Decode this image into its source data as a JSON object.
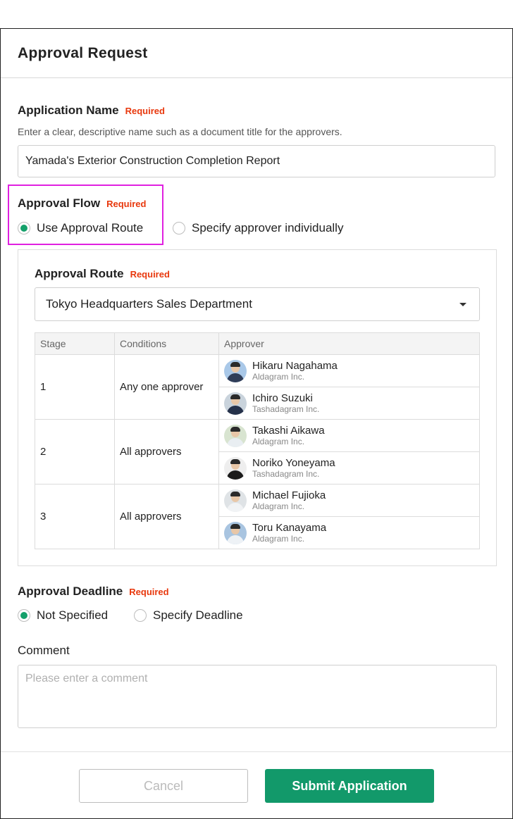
{
  "dialog": {
    "title": "Approval Request"
  },
  "application_name": {
    "label": "Application Name",
    "required": "Required",
    "hint": "Enter a clear, descriptive name such as a document title for the approvers.",
    "value": "Yamada's Exterior Construction Completion Report"
  },
  "approval_flow": {
    "label": "Approval Flow",
    "required": "Required",
    "options": [
      {
        "label": "Use Approval Route",
        "selected": true
      },
      {
        "label": "Specify approver individually",
        "selected": false
      }
    ]
  },
  "approval_route": {
    "label": "Approval Route",
    "required": "Required",
    "selected": "Tokyo Headquarters Sales Department",
    "columns": [
      "Stage",
      "Conditions",
      "Approver"
    ],
    "stages": [
      {
        "stage": "1",
        "condition": "Any one approver",
        "approvers": [
          {
            "name": "Hikaru Nagahama",
            "company": "Aldagram Inc."
          },
          {
            "name": "Ichiro Suzuki",
            "company": "Tashadagram Inc."
          }
        ]
      },
      {
        "stage": "2",
        "condition": "All approvers",
        "approvers": [
          {
            "name": "Takashi Aikawa",
            "company": "Aldagram Inc."
          },
          {
            "name": "Noriko Yoneyama",
            "company": "Tashadagram Inc."
          }
        ]
      },
      {
        "stage": "3",
        "condition": "All approvers",
        "approvers": [
          {
            "name": "Michael Fujioka",
            "company": "Aldagram Inc."
          },
          {
            "name": "Toru Kanayama",
            "company": "Aldagram Inc."
          }
        ]
      }
    ]
  },
  "approval_deadline": {
    "label": "Approval Deadline",
    "required": "Required",
    "options": [
      {
        "label": "Not Specified",
        "selected": true
      },
      {
        "label": "Specify Deadline",
        "selected": false
      }
    ]
  },
  "comment": {
    "label": "Comment",
    "placeholder": "Please enter a comment"
  },
  "footer": {
    "cancel_label": "Cancel",
    "submit_label": "Submit Application"
  },
  "colors": {
    "accent": "#12996a",
    "required": "#e8380d",
    "highlight": "#e020e0"
  }
}
